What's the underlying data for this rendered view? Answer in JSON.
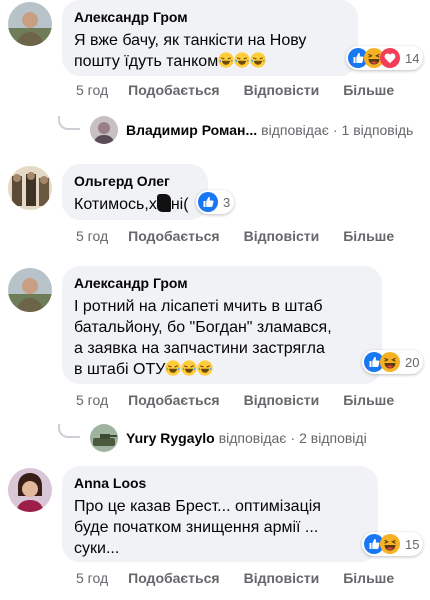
{
  "colors": {
    "like": "#1877f2",
    "haha": "#f7b125",
    "love": "#f33e58",
    "meta_text": "#65676b",
    "bubble": "#f0f2f5"
  },
  "actions": {
    "like": "Подобається",
    "reply": "Відповісти",
    "more": "Більше"
  },
  "comments": [
    {
      "author": "Александр Гром",
      "lines": [
        "Я вже бачу, як танкісти на Нову",
        "пошту їдуть танком"
      ],
      "emoji_tail": [
        "laughing-emoji",
        "laughing-emoji",
        "laughing-emoji"
      ],
      "reactions": [
        "like-icon",
        "haha-icon",
        "love-icon"
      ],
      "reaction_count": "14",
      "time": "5 год"
    },
    {
      "author": "Ольгерд Олег",
      "lines": [
        "Котимось,х",
        "ні("
      ],
      "reactions": [
        "like-icon"
      ],
      "reaction_count": "3",
      "time": "5 год"
    },
    {
      "author": "Александр Гром",
      "lines": [
        "І ротний на лісапеті мчить в штаб",
        "батальйону, бо \"Богдан\" зламався,",
        "а заявка на запчастини застрягла",
        "в штабі ОТУ"
      ],
      "emoji_tail": [
        "laughing-emoji",
        "laughing-emoji",
        "laughing-emoji"
      ],
      "reactions": [
        "like-icon",
        "haha-icon"
      ],
      "reaction_count": "20",
      "time": "5 год"
    },
    {
      "author": "Anna Loos",
      "lines": [
        "Про це казав Брест... оптимізація",
        "буде початком знищення армії ...",
        "суки..."
      ],
      "reactions": [
        "like-icon",
        "haha-icon"
      ],
      "reaction_count": "15",
      "time": "5 год"
    }
  ],
  "replies": [
    {
      "name": "Владимир Роман...",
      "verb": "відповідає",
      "count": "1 відповідь"
    },
    {
      "name": "Yury Rygaylo",
      "verb": "відповідає",
      "count": "2 відповіді"
    }
  ]
}
